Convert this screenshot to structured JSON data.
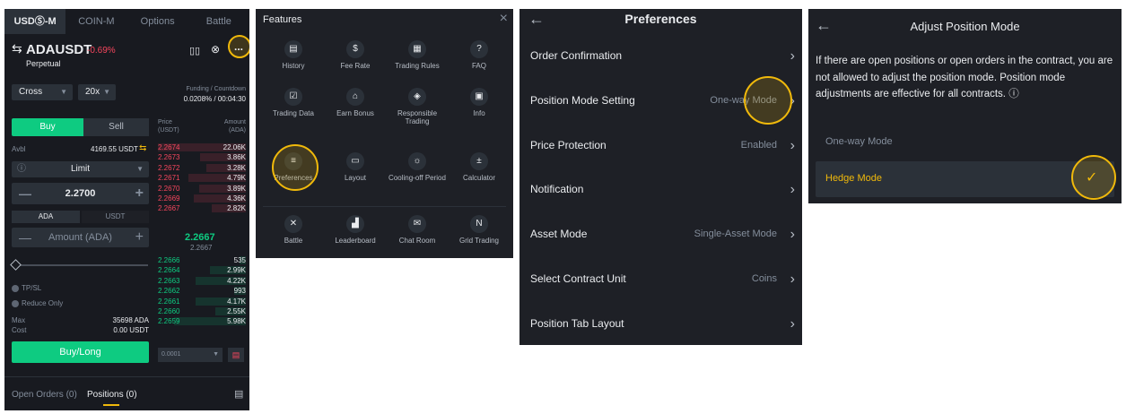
{
  "panel1": {
    "tabs": [
      "USDⓈ-M",
      "COIN-M",
      "Options",
      "Battle"
    ],
    "symbol": "ADAUSDT",
    "change": "-0.69%",
    "contract_type": "Perpetual",
    "more_label": "...",
    "margin_mode": "Cross",
    "leverage": "20x",
    "funding_label": "Funding / Countdown",
    "funding_value": "0.0208% / 00:04:30",
    "buy_tab": "Buy",
    "sell_tab": "Sell",
    "avbl_label": "Avbl",
    "avbl_value": "4169.55 USDT",
    "order_type": "Limit",
    "price_value": "2.2700",
    "unit_ada": "ADA",
    "unit_usdt": "USDT",
    "amount_placeholder": "Amount (ADA)",
    "tpsl_label": "TP/SL",
    "reduce_only_label": "Reduce Only",
    "max_label": "Max",
    "max_value": "35698 ADA",
    "cost_label": "Cost",
    "cost_value": "0.00 USDT",
    "buy_long_button": "Buy/Long",
    "orderbook": {
      "price_header": "Price\n(USDT)",
      "amount_header": "Amount\n(ADA)",
      "asks": [
        {
          "price": "2.2674",
          "amount": "22.06K"
        },
        {
          "price": "2.2673",
          "amount": "3.86K"
        },
        {
          "price": "2.2672",
          "amount": "3.28K"
        },
        {
          "price": "2.2671",
          "amount": "4.79K"
        },
        {
          "price": "2.2670",
          "amount": "3.89K"
        },
        {
          "price": "2.2669",
          "amount": "4.36K"
        },
        {
          "price": "2.2667",
          "amount": "2.82K"
        }
      ],
      "last_price": "2.2667",
      "mark_price": "2.2667",
      "bids": [
        {
          "price": "2.2666",
          "amount": "535"
        },
        {
          "price": "2.2664",
          "amount": "2.99K"
        },
        {
          "price": "2.2663",
          "amount": "4.22K"
        },
        {
          "price": "2.2662",
          "amount": "993"
        },
        {
          "price": "2.2661",
          "amount": "4.17K"
        },
        {
          "price": "2.2660",
          "amount": "2.55K"
        },
        {
          "price": "2.2659",
          "amount": "5.98K"
        }
      ],
      "precision": "0.0001"
    },
    "open_orders_tab": "Open Orders (0)",
    "positions_tab": "Positions (0)"
  },
  "panel2": {
    "title": "Features",
    "close": "×",
    "items": [
      {
        "label": "History",
        "glyph": "▤"
      },
      {
        "label": "Fee Rate",
        "glyph": "$"
      },
      {
        "label": "Trading Rules",
        "glyph": "▦"
      },
      {
        "label": "FAQ",
        "glyph": "?"
      },
      {
        "label": "Trading Data",
        "glyph": "☑"
      },
      {
        "label": "Earn Bonus",
        "glyph": "⌂"
      },
      {
        "label": "Responsible Trading",
        "glyph": "◈"
      },
      {
        "label": "Info",
        "glyph": "▣"
      },
      {
        "label": "Preferences",
        "glyph": "≡"
      },
      {
        "label": "Layout",
        "glyph": "▭"
      },
      {
        "label": "Cooling-off Period",
        "glyph": "☼"
      },
      {
        "label": "Calculator",
        "glyph": "±"
      },
      {
        "label": "Battle",
        "glyph": "✕"
      },
      {
        "label": "Leaderboard",
        "glyph": "▟"
      },
      {
        "label": "Chat Room",
        "glyph": "✉"
      },
      {
        "label": "Grid Trading",
        "glyph": "N"
      }
    ]
  },
  "panel3": {
    "back": "←",
    "title": "Preferences",
    "rows": [
      {
        "label": "Order Confirmation",
        "value": ""
      },
      {
        "label": "Position Mode Setting",
        "value": "One-way Mode"
      },
      {
        "label": "Price Protection",
        "value": "Enabled"
      },
      {
        "label": "Notification",
        "value": ""
      },
      {
        "label": "Asset Mode",
        "value": "Single-Asset Mode"
      },
      {
        "label": "Select Contract Unit",
        "value": "Coins"
      },
      {
        "label": "Position Tab Layout",
        "value": ""
      }
    ]
  },
  "panel4": {
    "back": "←",
    "title": "Adjust Position Mode",
    "description": "If there are open positions or open orders in the contract, you are not allowed to adjust the position mode. Position mode adjustments are effective for all contracts.",
    "info_icon": "ⓘ",
    "option_oneway": "One-way Mode",
    "option_hedge": "Hedge Mode",
    "check": "✓"
  },
  "colors": {
    "accent": "#f0b90b",
    "buy": "#0ecb81",
    "sell": "#f6465d",
    "bg": "#1e2026"
  }
}
